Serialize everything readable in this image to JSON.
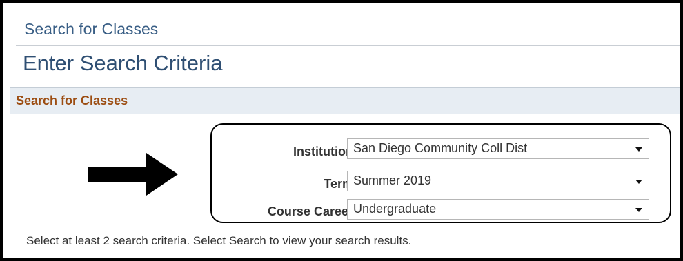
{
  "header": {
    "breadcrumb": "Search for Classes",
    "page_title": "Enter Search Criteria"
  },
  "section": {
    "title": "Search for Classes"
  },
  "fields": [
    {
      "label": "Institution",
      "value": "San Diego Community Coll Dist"
    },
    {
      "label": "Term",
      "value": "Summer 2019"
    },
    {
      "label": "Course Career",
      "value": "Undergraduate"
    }
  ],
  "instructions": "Select at least 2 search criteria. Select Search to view your search results.",
  "icons": {
    "pointer": "arrow-right-icon",
    "dropdown": "chevron-down-icon"
  },
  "colors": {
    "breadcrumb": "#3a5f86",
    "title": "#2f4f73",
    "section_title": "#9c4d12",
    "section_bg": "#e7edf3"
  }
}
